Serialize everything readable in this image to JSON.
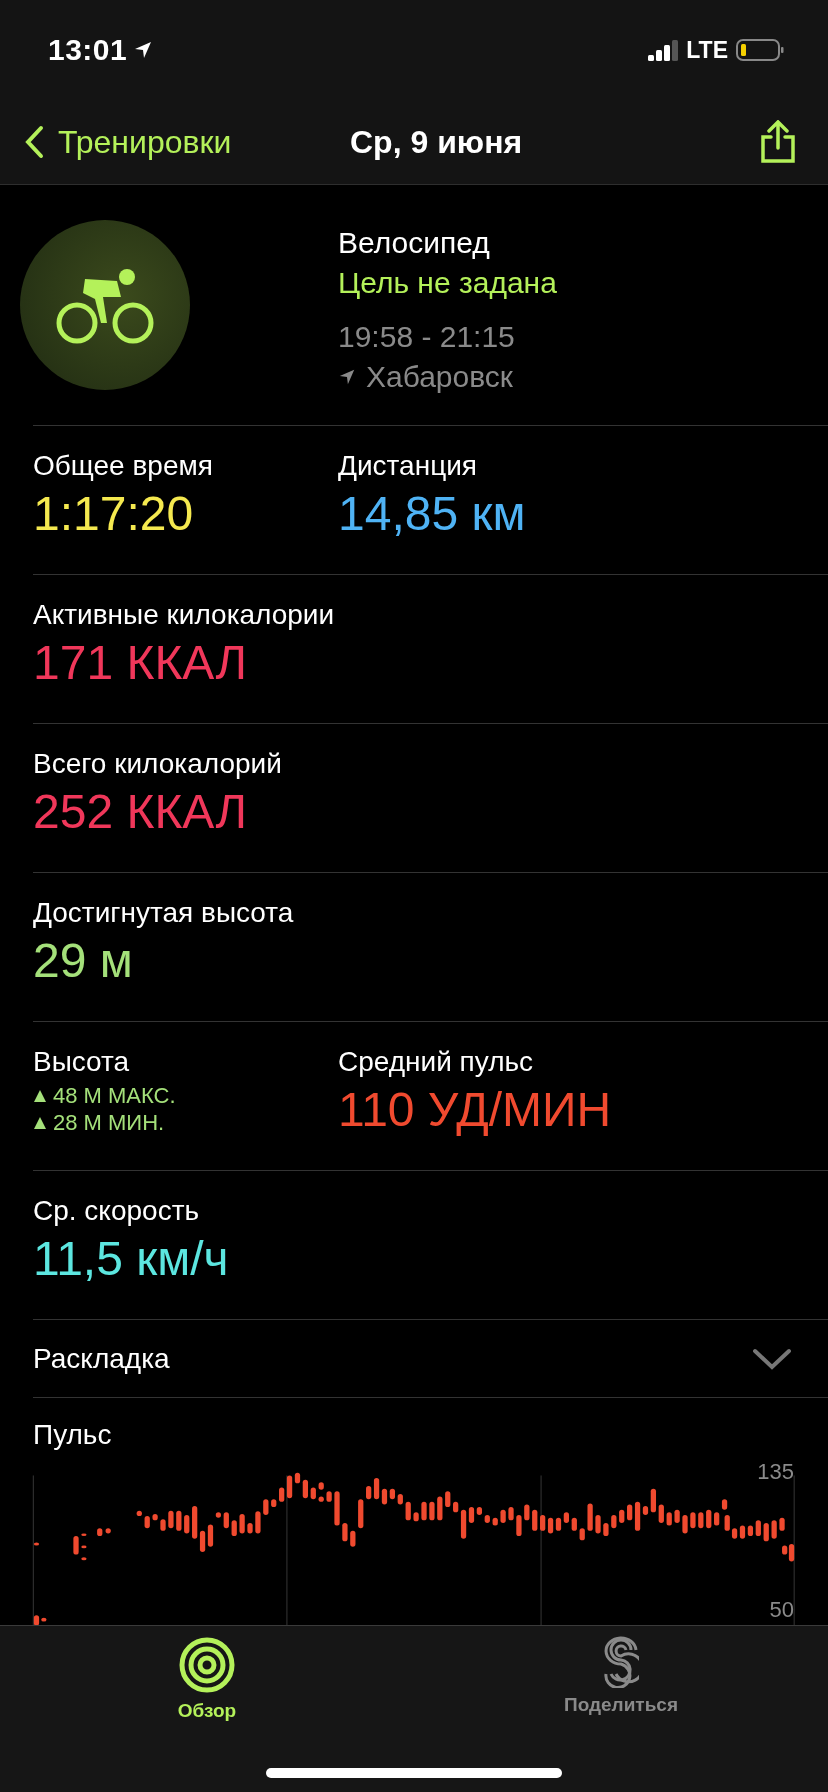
{
  "status_bar": {
    "time": "13:01",
    "network": "LTE"
  },
  "nav": {
    "back_label": "Тренировки",
    "title": "Ср, 9 июня"
  },
  "workout": {
    "name": "Велосипед",
    "goal": "Цель не задана",
    "time_range": "19:58 - 21:15",
    "location": "Хабаровск"
  },
  "metric_rows": [
    {
      "items": [
        {
          "kind": "value",
          "label": "Общее время",
          "value": "1:17:20",
          "color": "#f5e94f"
        },
        {
          "kind": "value",
          "label": "Дистанция",
          "value": "14,85 км",
          "color": "#4fb3f5"
        }
      ]
    },
    {
      "items": [
        {
          "kind": "value",
          "label": "Активные килокалории",
          "value": "171 ККАЛ",
          "color": "#f0375a"
        }
      ]
    },
    {
      "items": [
        {
          "kind": "value",
          "label": "Всего килокалорий",
          "value": "252 ККАЛ",
          "color": "#f0375a"
        }
      ]
    },
    {
      "items": [
        {
          "kind": "value",
          "label": "Достигнутая высота",
          "value": "29 м",
          "color": "#a4e07a"
        }
      ]
    },
    {
      "items": [
        {
          "kind": "range",
          "label": "Высота",
          "max": "48 М МАКС.",
          "min": "28 М МИН.",
          "color": "#a4e07a"
        },
        {
          "kind": "value",
          "label": "Средний пульс",
          "value": "110 УД/МИН",
          "color": "#f04a2f"
        }
      ]
    },
    {
      "items": [
        {
          "kind": "value",
          "label": "Ср. скорость",
          "value": "11,5 км/ч",
          "color": "#5ce6e0"
        }
      ]
    }
  ],
  "splits": {
    "label": "Раскладка",
    "expanded": false
  },
  "heart_rate": {
    "title": "Пульс",
    "y_max_label": "135",
    "y_min_label": "50"
  },
  "tabs": [
    {
      "label": "Обзор",
      "selected": true
    },
    {
      "label": "Поделиться",
      "selected": false
    }
  ]
}
